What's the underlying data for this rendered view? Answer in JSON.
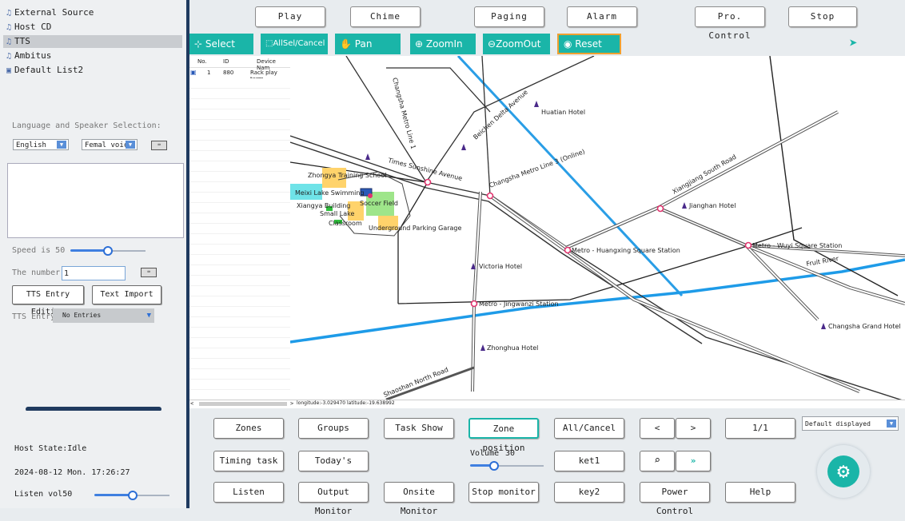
{
  "sources": [
    {
      "icon": "music-note-icon",
      "label": "External Source"
    },
    {
      "icon": "music-note-icon",
      "label": "Host CD"
    },
    {
      "icon": "music-note-icon",
      "label": "TTS"
    },
    {
      "icon": "music-note-icon",
      "label": "Ambitus"
    },
    {
      "icon": "playlist-icon",
      "label": "Default List2"
    }
  ],
  "tts": {
    "lang_title": "Language and Speaker Selection:",
    "language": "English",
    "voice": "Femal voice",
    "text_value": "",
    "speed_label": "Speed is 50",
    "speed_value": 50,
    "number_label": "The number",
    "number_value": "1",
    "entry_edit_btn": "TTS Entry Editing",
    "import_btn": "Text Import",
    "entry_label": "TTS Entry",
    "entry_value": "No Entries"
  },
  "toolbar": [
    "Play",
    "Chime",
    "Paging",
    "Alarm",
    "Pro. Control",
    "Stop"
  ],
  "tools": {
    "select": "Select",
    "allsel": "AllSel/Cancel",
    "pan": "Pan",
    "zoomin": "ZoomIn",
    "zoomout": "ZoomOut",
    "reset": "Reset"
  },
  "device_table": {
    "headers": [
      "No.",
      "ID",
      "Device Nam"
    ],
    "rows": [
      [
        "1",
        "880",
        "Rack play term"
      ]
    ]
  },
  "map": {
    "coords": "longitude:-3.029470 latitude:-19.638992",
    "labels": {
      "line1": "Changsha Metro Line 1",
      "beichen": "Beichen Delta Avenue",
      "huatian": "Huatian Hotel",
      "times": "Times Sunshine Avenue",
      "line3": "Changsha Metro Line 3 (Online)",
      "xiangjiang": "Xiangjiang South Road",
      "zhongya": "Zhongya Training School",
      "meixi": "Meixi Lake Swimming",
      "xiangya": "Xiangya Building",
      "soccer": "Soccer Field",
      "smalllake": "Small Lake",
      "classroom": "Classroom",
      "garage": "Underground Parking Garage",
      "jianghan": "Jianghan Hotel",
      "huangxing": "Metro - Huangxing Square Station",
      "wuyi": "Metro - Wuyi Square Station",
      "fruitriver": "Fruit River",
      "victoria": "Victoria Hotel",
      "jingwanzi": "Metro - Jingwanzi Station",
      "grand": "Changsha Grand Hotel",
      "zhonghua": "Zhonghua Hotel",
      "shaoshan": "Shaoshan North Road"
    }
  },
  "host": {
    "state": "Host State:Idle",
    "datetime": "2024-08-12 Mon. 17:26:27",
    "listen_label": "Listen vol50",
    "listen_value": 50
  },
  "bottom": {
    "zones": "Zones",
    "groups": "Groups",
    "taskshow": "Task Show",
    "zonepos": "Zone position",
    "allcancel": "All/Cancel",
    "prev": "<",
    "next": ">",
    "page": "1/1",
    "display": "Default displayed",
    "timing": "Timing task",
    "todays": "Today's",
    "volume_label": "Volume",
    "volume_value": "30",
    "ket1": "ket1",
    "search_icon": "search-icon",
    "forward_icon": "fast-forward-icon",
    "listen": "Listen",
    "output": "Output Monitor",
    "onsite": "Onsite Monitor",
    "stopmon": "Stop monitor",
    "key2": "key2",
    "power": "Power Control",
    "help": "Help",
    "gear_icon": "gear-icon"
  },
  "colors": {
    "accent": "#1ab5a8",
    "metro_blue": "#2a9ee6",
    "river_blue": "#1e9be8",
    "slider": "#3f7fe0",
    "reset_border": "#f0a030"
  }
}
